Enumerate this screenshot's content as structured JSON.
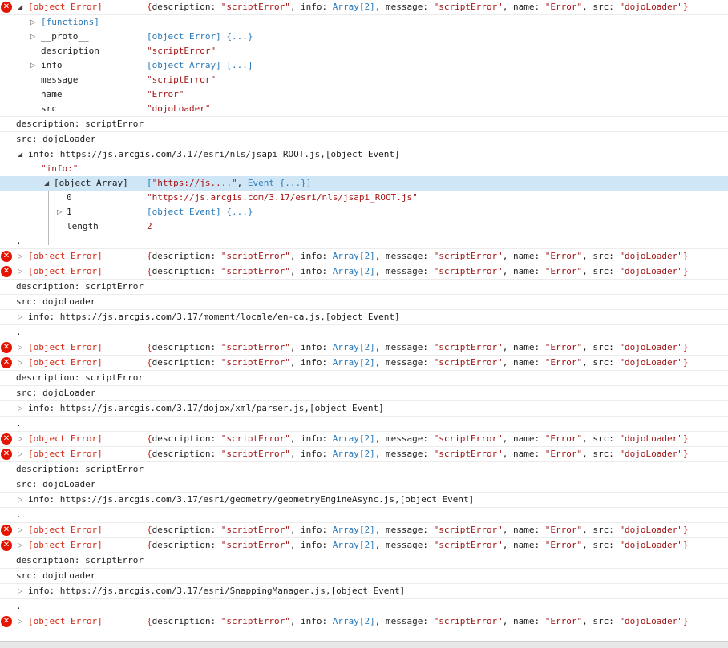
{
  "error_label": "[object Error]",
  "error_summary": {
    "open": "{",
    "k_description": "description: ",
    "v_description": "\"scriptError\"",
    "k_info": ", info: ",
    "v_info": "Array[2]",
    "k_message": ", message: ",
    "v_message": "\"scriptError\"",
    "k_name": ", name: ",
    "v_name": "\"Error\"",
    "k_src": ", src: ",
    "v_src": "\"dojoLoader\"",
    "close": "}"
  },
  "expanded_error": {
    "functions_label": "[functions]",
    "props": [
      {
        "key": "__proto__",
        "value": "[object Error] {...}"
      },
      {
        "key": "description",
        "value": "\"scriptError\""
      },
      {
        "key": "info",
        "value": "[object Array] [...]"
      },
      {
        "key": "message",
        "value": "\"scriptError\""
      },
      {
        "key": "name",
        "value": "\"Error\""
      },
      {
        "key": "src",
        "value": "\"dojoLoader\""
      }
    ]
  },
  "log_lines": {
    "description": "description: scriptError",
    "src": "src: dojoLoader",
    "dot": "."
  },
  "info_lines": [
    "info: https://js.arcgis.com/3.17/esri/nls/jsapi_ROOT.js,[object Event]",
    "info: https://js.arcgis.com/3.17/moment/locale/en-ca.js,[object Event]",
    "info: https://js.arcgis.com/3.17/dojox/xml/parser.js,[object Event]",
    "info: https://js.arcgis.com/3.17/esri/geometry/geometryEngineAsync.js,[object Event]",
    "info: https://js.arcgis.com/3.17/esri/SnappingManager.js,[object Event]"
  ],
  "info_tree": {
    "header": "\"info:\"",
    "array_label": "[object Array]",
    "array_preview_open": "[",
    "array_preview_str": "\"https://js....\"",
    "array_preview_sep": ", ",
    "array_preview_event": "Event {...}",
    "array_preview_close": "]",
    "items": [
      {
        "key": "0",
        "value": "\"https://js.arcgis.com/3.17/esri/nls/jsapi_ROOT.js\""
      },
      {
        "key": "1",
        "value": "[object Event] {...}"
      },
      {
        "key": "length",
        "value": "2"
      }
    ]
  },
  "colors": {
    "error_red": "#e51400",
    "string": "#a31515",
    "object_blue": "#2b7ab8",
    "selected_row": "#cfe6f7"
  }
}
